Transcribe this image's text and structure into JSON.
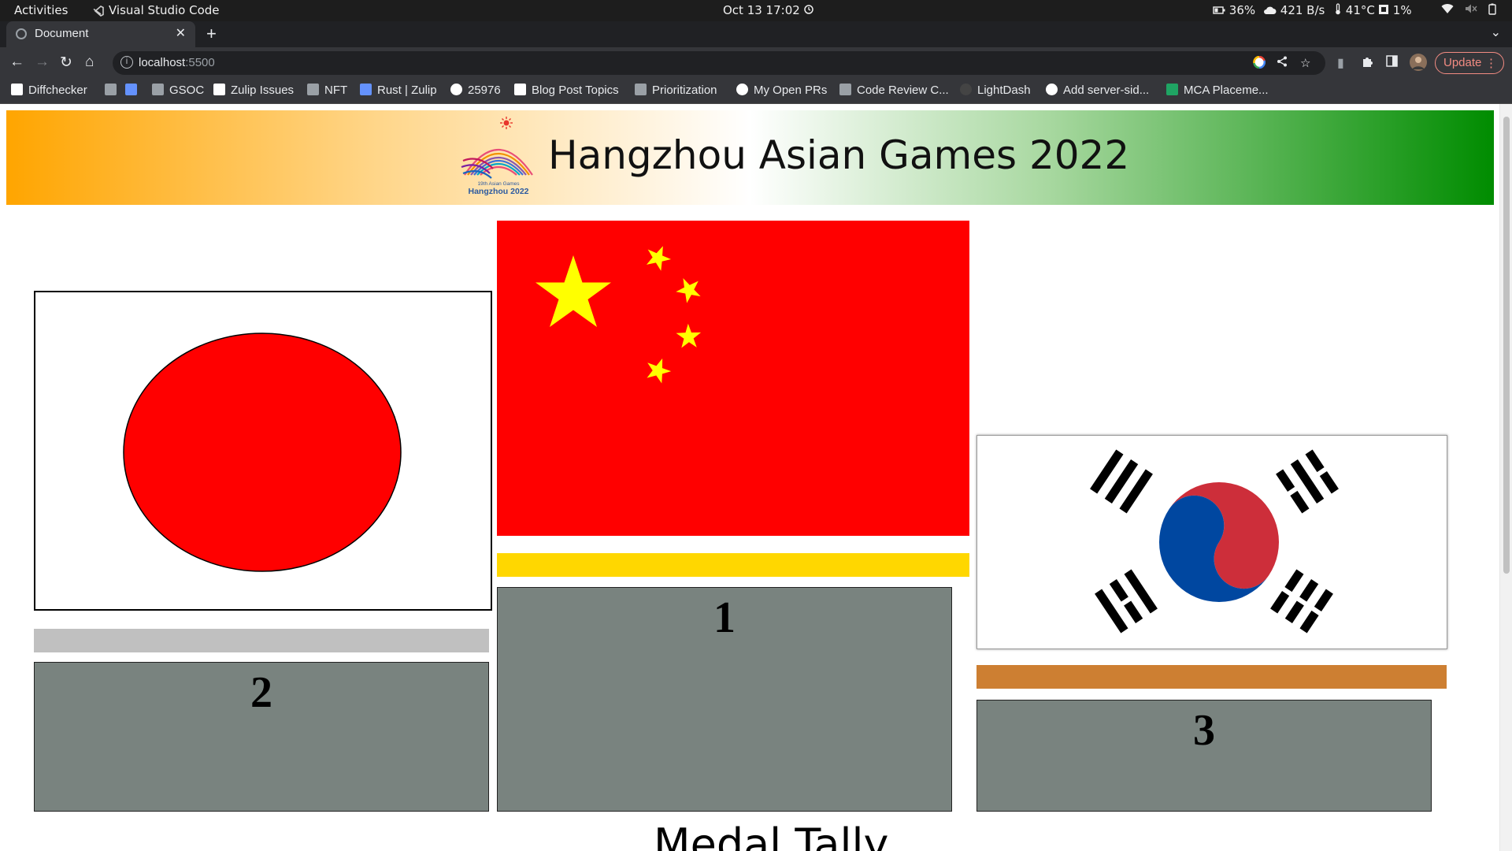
{
  "os_bar": {
    "activities": "Activities",
    "app_name": "Visual Studio Code",
    "datetime": "Oct 13  17:02",
    "battery_charge": "36%",
    "network_speed": "421 B/s",
    "temperature": "41°C",
    "cpu": "1%"
  },
  "browser": {
    "tab_title": "Document",
    "new_tab": "+",
    "url_host": "localhost",
    "url_port": ":5500",
    "update_label": "Update",
    "bookmarks": [
      {
        "label": "Diffchecker",
        "icon": "diffchecker-icon",
        "color": "#ffffff"
      },
      {
        "label": "",
        "icon": "folder-icon",
        "color": "#9aa0a6"
      },
      {
        "label": "",
        "icon": "zulip-icon",
        "color": "#6492fd"
      },
      {
        "label": "GSOC",
        "icon": "folder-icon",
        "color": "#9aa0a6"
      },
      {
        "label": "Zulip Issues",
        "icon": "notion-icon",
        "color": "#ffffff"
      },
      {
        "label": "NFT",
        "icon": "sheet-icon",
        "color": "#9aa0a6"
      },
      {
        "label": "Rust | Zulip",
        "icon": "zulip-icon",
        "color": "#6492fd"
      },
      {
        "label": "25976",
        "icon": "github-icon",
        "color": "#ffffff"
      },
      {
        "label": "Blog Post Topics",
        "icon": "notion-icon",
        "color": "#ffffff"
      },
      {
        "label": "Prioritization",
        "icon": "sheet-icon",
        "color": "#9aa0a6"
      },
      {
        "label": "My Open PRs",
        "icon": "github-icon",
        "color": "#ffffff"
      },
      {
        "label": "Code Review C...",
        "icon": "sheet-icon",
        "color": "#9aa0a6"
      },
      {
        "label": "LightDash",
        "icon": "lightdash-icon",
        "color": "#444444"
      },
      {
        "label": "Add server-sid...",
        "icon": "github-icon",
        "color": "#ffffff"
      },
      {
        "label": "MCA Placeme...",
        "icon": "sheets-green-icon",
        "color": "#1fa463"
      }
    ]
  },
  "page": {
    "banner_title": "Hangzhou Asian Games 2022",
    "logo_caption_line1": "19th Asian Games",
    "logo_caption_line2": "Hangzhou 2022",
    "podium": [
      {
        "rank": "2",
        "country_flag": "japan-flag",
        "medal_color": "#c0c0c0"
      },
      {
        "rank": "1",
        "country_flag": "china-flag",
        "medal_color": "#ffd700"
      },
      {
        "rank": "3",
        "country_flag": "south-korea-flag",
        "medal_color": "#cd7f32"
      }
    ],
    "podium_color": "#79837f",
    "section_heading": "Medal Tally"
  }
}
